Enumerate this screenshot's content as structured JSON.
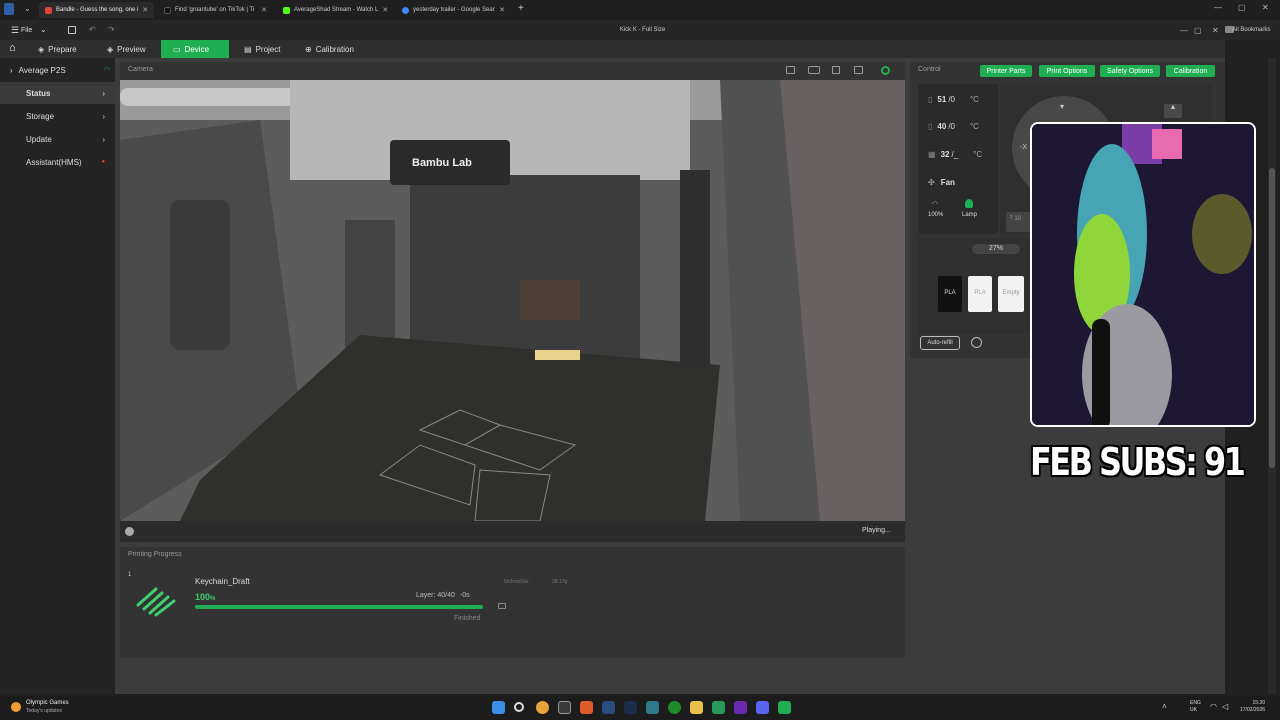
{
  "browser": {
    "tabs": [
      {
        "title": "Bandle - Guess the song, one i",
        "color": "#e0443b"
      },
      {
        "title": "Find 'groantube' on TikTok | Ti",
        "color": "#111111"
      },
      {
        "title": "AverageShad Stream - Watch L",
        "color": "#53fc18"
      },
      {
        "title": "yesterday trailer - Google Sear",
        "color": "#4285f4"
      }
    ],
    "new_tab": "+",
    "bookmarks": "All Bookmarks"
  },
  "app": {
    "window_title": "Kick K - Full Size",
    "file_menu": "File",
    "nav": {
      "prepare": "Prepare",
      "preview": "Preview",
      "device": "Device",
      "project": "Project",
      "calibration": "Calibration"
    }
  },
  "sidebar": {
    "printer": "Average P2S",
    "items": [
      {
        "label": "Status"
      },
      {
        "label": "Storage"
      },
      {
        "label": "Update"
      },
      {
        "label": "Assistant(HMS)"
      }
    ]
  },
  "camera": {
    "title": "Camera",
    "status": "Playing...",
    "brand": "Bambu Lab"
  },
  "progress": {
    "title": "Printing Progress",
    "plate": "1",
    "name": "Keychain_Draft",
    "percent": "100",
    "percent_unit": "%",
    "fraction": 1.0,
    "layer": "Layer: 40/40",
    "remaining": "-0s",
    "time": "5h2min54s",
    "weight": "28.17g",
    "state": "Finished"
  },
  "control": {
    "title": "Control",
    "buttons": [
      "Printer Parts",
      "Print Options",
      "Safety Options",
      "Calibration"
    ],
    "temps": [
      {
        "current": "51",
        "target": "/0",
        "unit": "°C"
      },
      {
        "current": "40",
        "target": "/0",
        "unit": "°C"
      },
      {
        "current": "32",
        "target": "/_",
        "unit": "°C"
      }
    ],
    "fan": "Fan",
    "fan_speed": "100%",
    "lamp": "Lamp",
    "humidity": "27%",
    "filaments": [
      "PLA",
      "PLA",
      "Empty"
    ],
    "auto_refill": "Auto-refill"
  },
  "overlay": {
    "subs": "FEB SUBS: 91"
  },
  "taskbar": {
    "widget_title": "Olympic Games",
    "widget_sub": "Today's updates",
    "lang": "ENG",
    "region": "UK",
    "time": "15:20",
    "date": "17/02/2026"
  }
}
